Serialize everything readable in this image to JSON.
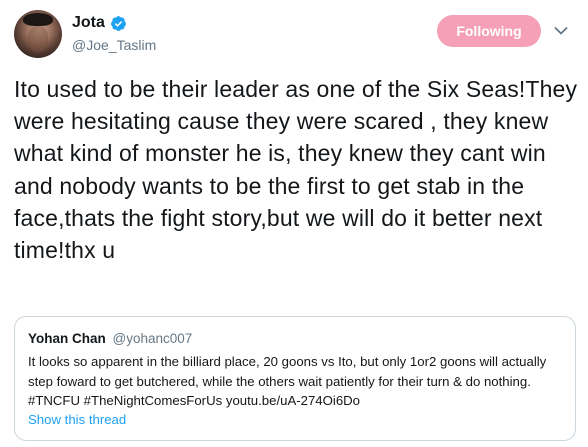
{
  "author": {
    "display_name": "Jota",
    "handle": "@Joe_Taslim",
    "verified": true
  },
  "follow_button": {
    "label": "Following",
    "color": "#f5a0b6"
  },
  "tweet": {
    "text": "Ito used to be their leader as one of the Six Seas!They were hesitating cause they were scared , they knew what kind of monster he is, they knew they cant win and nobody wants to be the first to get stab in the face,thats the fight story,but we will do it better next time!thx u"
  },
  "quoted_tweet": {
    "display_name": "Yohan Chan",
    "handle": "@yohanc007",
    "text": "It looks so apparent in the billiard place, 20 goons vs Ito, but only 1or2 goons will actually step foward to get butchered, while the others wait patiently for their turn & do nothing. #TNCFU #TheNightComesForUs youtu.be/uA-274Oi6Do",
    "show_thread_label": "Show this thread"
  },
  "colors": {
    "link": "#1da1f2",
    "secondary_text": "#657786",
    "border": "#ccd6dd",
    "verified_badge": "#1da1f2"
  },
  "icons": [
    "avatar",
    "verified-badge-icon",
    "chevron-down-icon"
  ]
}
